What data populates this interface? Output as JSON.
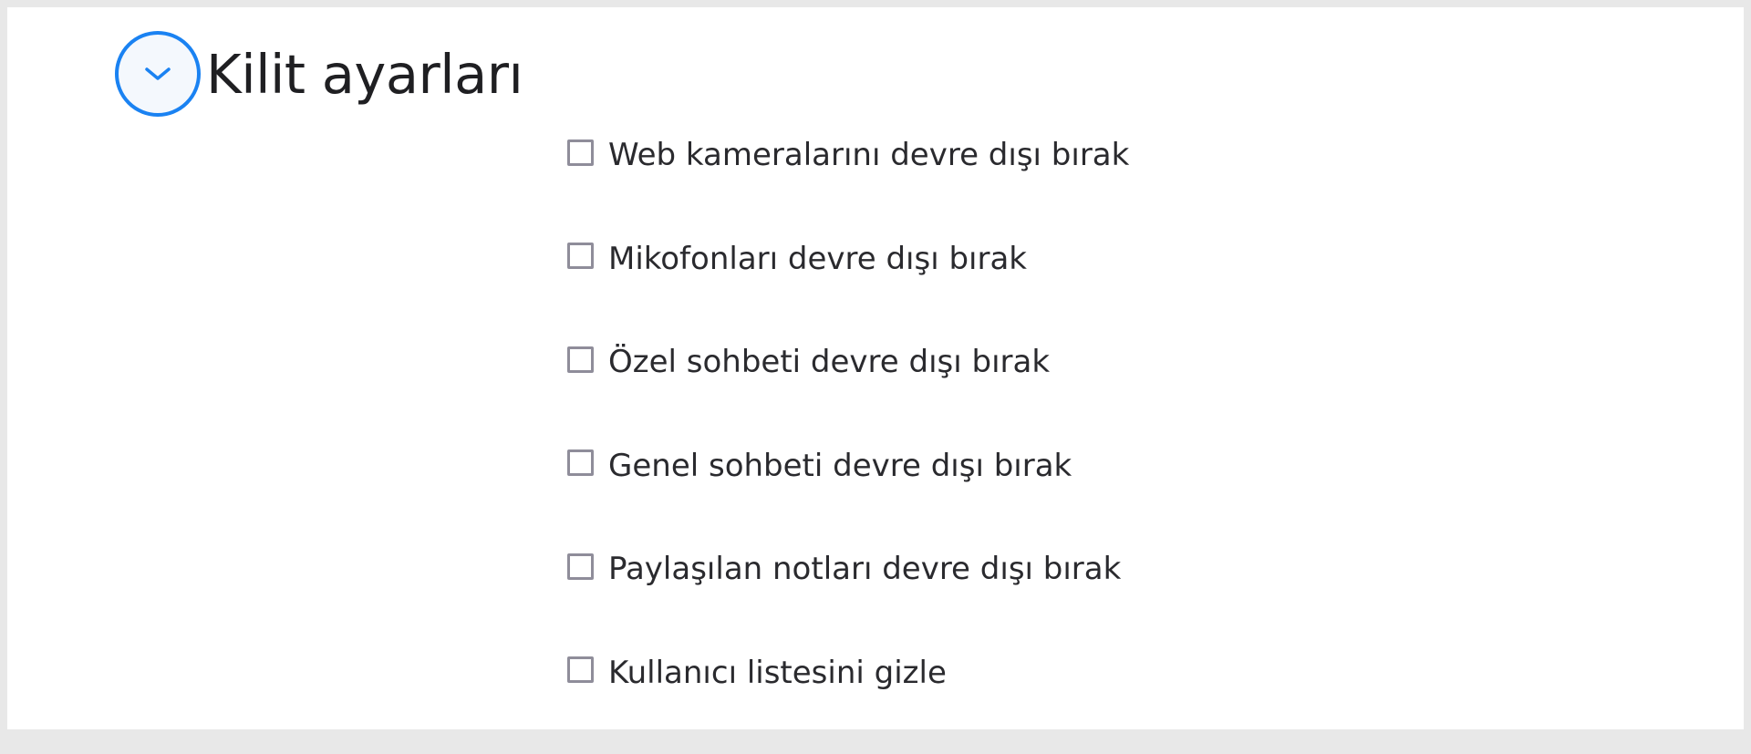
{
  "section": {
    "title": "Kilit ayarları",
    "toggle_icon": "chevron-down-icon",
    "accent_color": "#1a82f2"
  },
  "options": [
    {
      "label": "Web kameralarını devre dışı bırak",
      "checked": false
    },
    {
      "label": "Mikofonları devre dışı bırak",
      "checked": false
    },
    {
      "label": "Özel sohbeti devre dışı bırak",
      "checked": false
    },
    {
      "label": "Genel sohbeti devre dışı bırak",
      "checked": false
    },
    {
      "label": "Paylaşılan notları devre dışı bırak",
      "checked": false
    },
    {
      "label": "Kullanıcı listesini gizle",
      "checked": false
    }
  ]
}
